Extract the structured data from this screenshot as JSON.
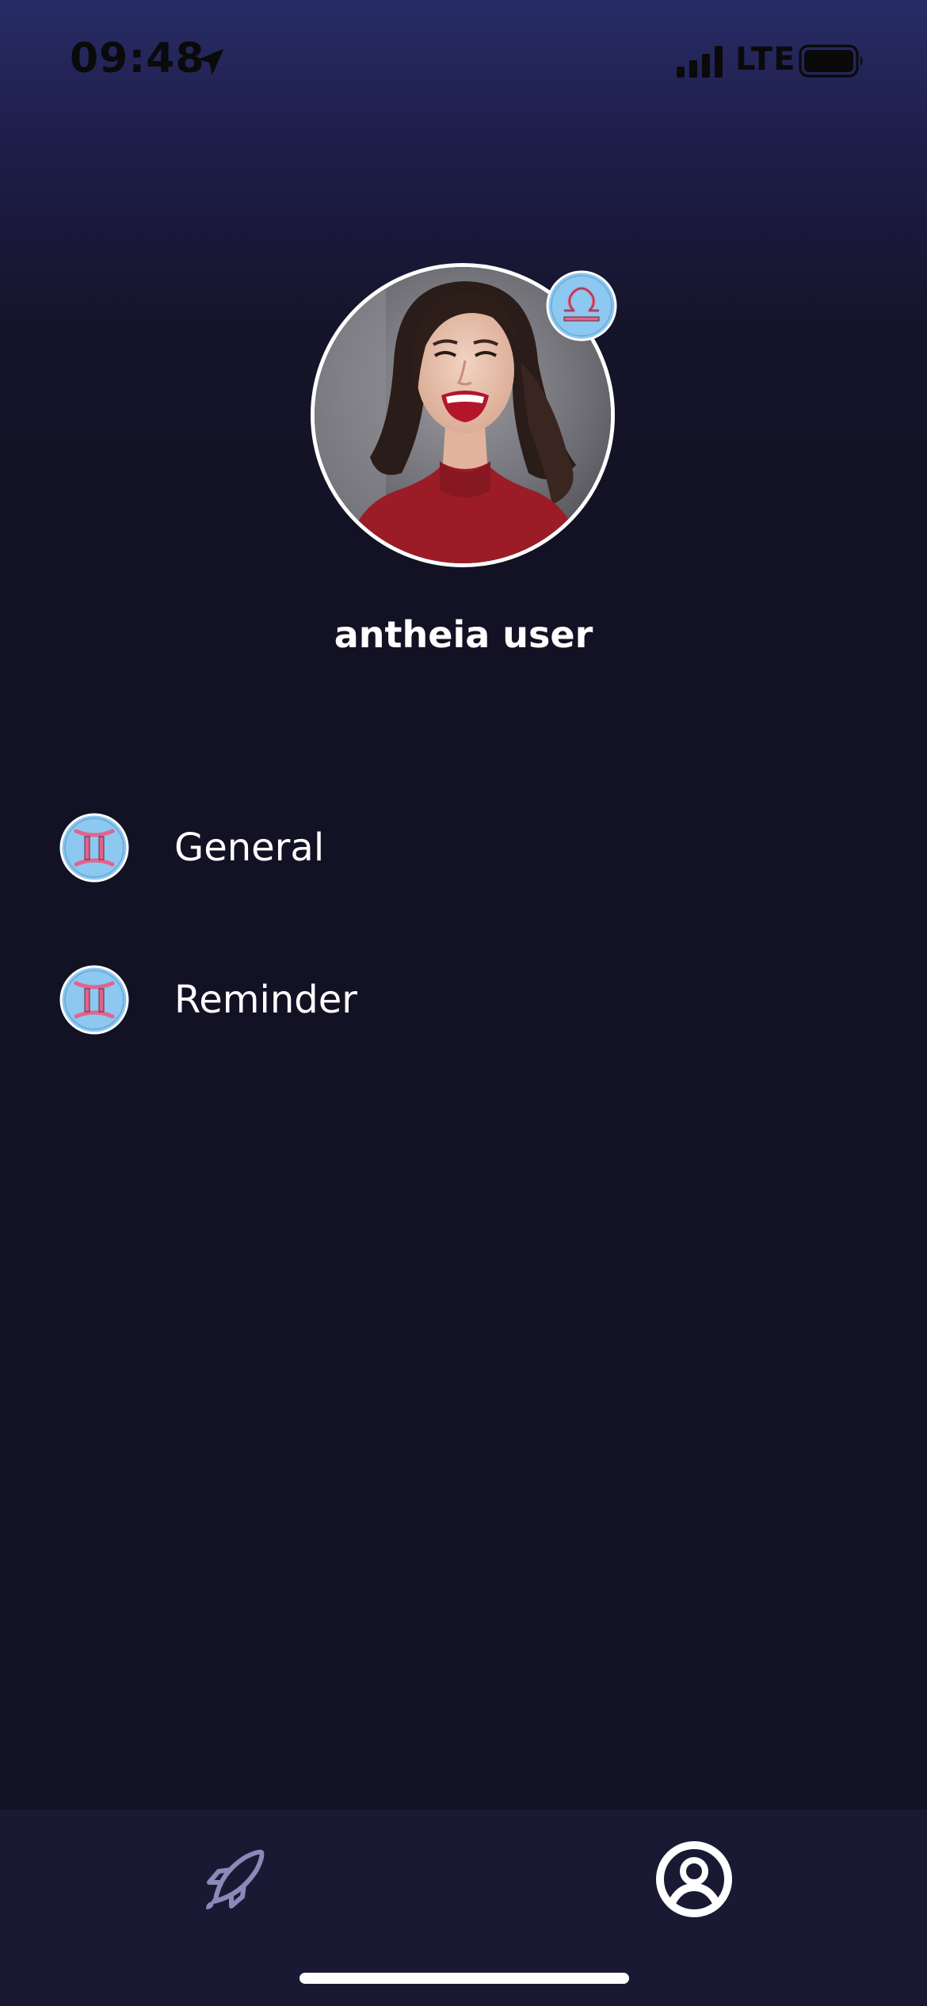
{
  "status_bar": {
    "time": "09:48",
    "network": "LTE"
  },
  "profile": {
    "username": "antheia user",
    "avatar": "profile-photo",
    "zodiac_sign": "libra-icon"
  },
  "menu": {
    "items": [
      {
        "label": "General",
        "icon": "gemini-icon"
      },
      {
        "label": "Reminder",
        "icon": "gemini-icon"
      }
    ]
  },
  "tab_bar": {
    "tabs": [
      {
        "icon": "rocket-icon",
        "active": false
      },
      {
        "icon": "profile-icon",
        "active": true
      }
    ]
  },
  "colors": {
    "background": "#131224",
    "header_gradient_top": "#282c66",
    "badge_fill": "#8cc8f0",
    "badge_symbol": "#e5628c",
    "tab_bar": "#1a1933",
    "inactive_tab": "#8a89b8"
  }
}
